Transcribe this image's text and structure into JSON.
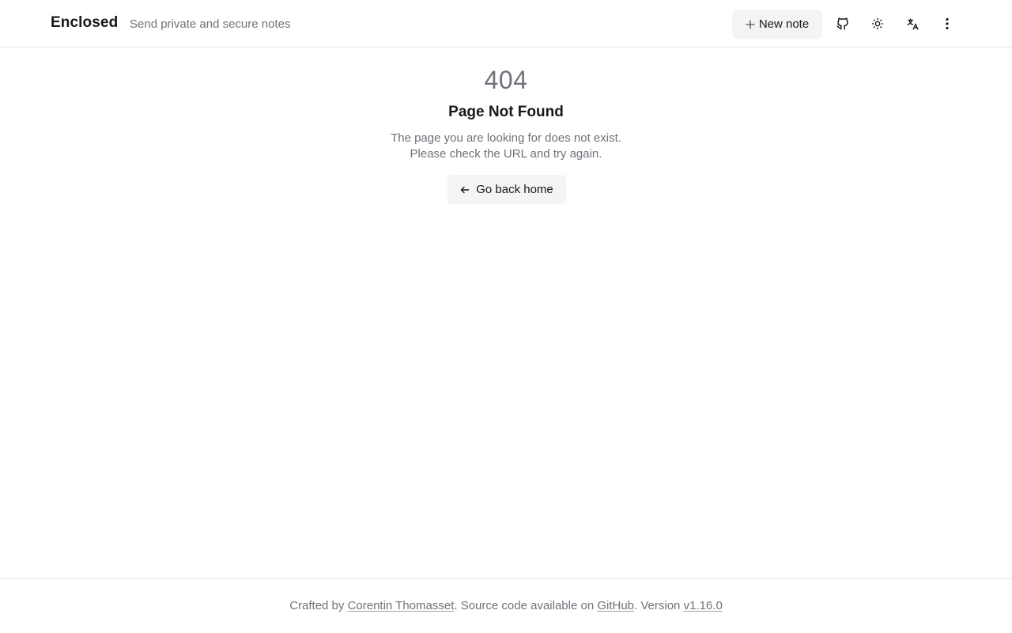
{
  "header": {
    "brand": "Enclosed",
    "tagline": "Send private and secure notes",
    "new_note_label": "New note",
    "icons": [
      "github-icon",
      "sun-icon",
      "translate-icon",
      "more-vertical-icon"
    ]
  },
  "main": {
    "code": "404",
    "title": "Page Not Found",
    "description_line1": "The page you are looking for does not exist.",
    "description_line2": "Please check the URL and try again.",
    "back_label": "Go back home"
  },
  "footer": {
    "crafted_by": "Crafted by",
    "author": "Corentin Thomasset",
    "source_text": ". Source code available on",
    "github": "GitHub",
    "version_text": ". Version",
    "version": "v1.16.0"
  },
  "colors": {
    "text": "#18181b",
    "muted": "#71717a",
    "button_bg": "#f4f4f5",
    "border": "#e6e6e9"
  }
}
